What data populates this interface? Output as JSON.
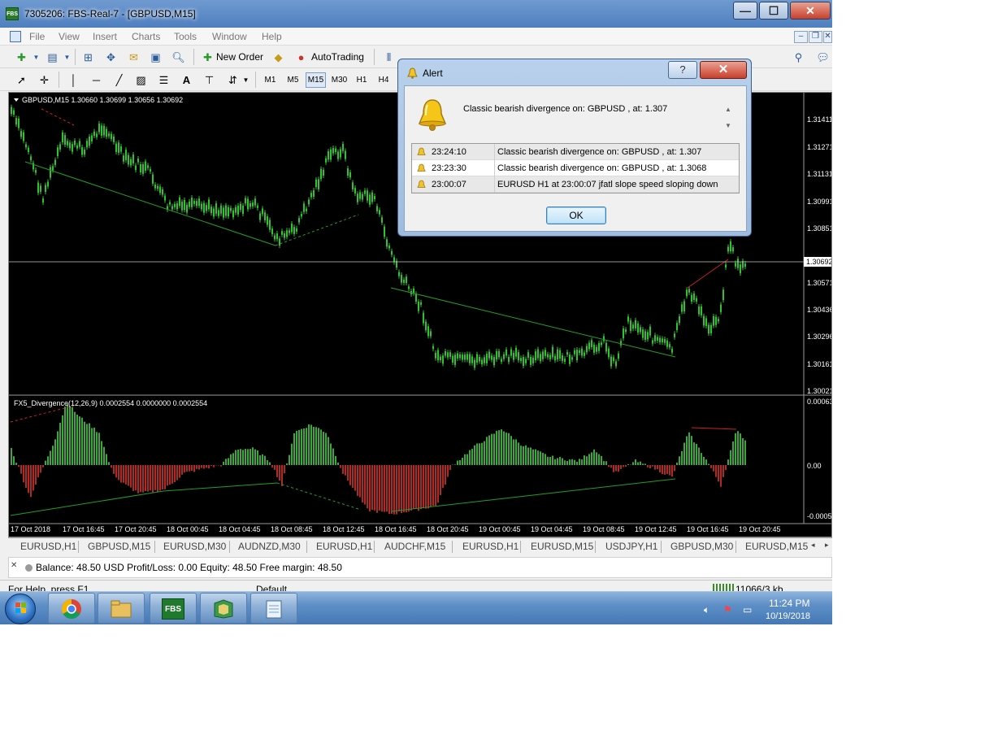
{
  "window": {
    "app_icon": "FBS",
    "title": "7305206: FBS-Real-7 - [GBPUSD,M15]",
    "minimize_label": "—",
    "maximize_label": "☐",
    "close_label": "✕"
  },
  "menu": {
    "items": [
      "File",
      "View",
      "Insert",
      "Charts",
      "Tools",
      "Window",
      "Help"
    ],
    "mdi": {
      "minimize": "–",
      "restore": "❐",
      "close": "✕"
    }
  },
  "toolbar": {
    "new_order_label": "New Order",
    "autotrading_label": "AutoTrading",
    "text_tool_label": "A",
    "timeframes": [
      "M1",
      "M5",
      "M15",
      "M30",
      "H1",
      "H4"
    ],
    "active_timeframe": "M15"
  },
  "chart": {
    "main_label": "GBPUSD,M15  1.30660 1.30699 1.30656 1.30692",
    "price_ticks": [
      "1.31411",
      "1.31271",
      "1.31131",
      "1.30991",
      "1.30851",
      "1.30716",
      "1.30571",
      "1.30436",
      "1.30296",
      "1.30161",
      "1.30021"
    ],
    "current_price": "1.30692",
    "indicator_label": "FX5_Divergence(12,26,9) 0.0002554 0.0000000 0.0002554",
    "indicator_ticks": [
      "0.00063",
      "0.00",
      "-0.00050"
    ],
    "time_ticks": [
      "17 Oct 2018",
      "17 Oct 16:45",
      "17 Oct 20:45",
      "18 Oct 00:45",
      "18 Oct 04:45",
      "18 Oct 08:45",
      "18 Oct 12:45",
      "18 Oct 16:45",
      "18 Oct 20:45",
      "19 Oct 00:45",
      "19 Oct 04:45",
      "19 Oct 08:45",
      "19 Oct 12:45",
      "19 Oct 16:45",
      "19 Oct 20:45"
    ],
    "colors": {
      "background": "#000000",
      "candles": "#2dc42d",
      "hist_up": "#3aa83a",
      "hist_down": "#b12a22",
      "axis_text": "#ffffff"
    }
  },
  "tabs": [
    "EURUSD,H1",
    "GBPUSD,M15",
    "EURUSD,M30",
    "AUDNZD,M30",
    "EURUSD,H1",
    "AUDCHF,M15",
    "EURUSD,H1",
    "EURUSD,M15",
    "USDJPY,H1",
    "GBPUSD,M30",
    "EURUSD,M15"
  ],
  "tab_scroll": {
    "left": "◂",
    "right": "▸"
  },
  "terminal": {
    "close_label": "✕",
    "balance_text": "Balance: 48.50 USD  Profit/Loss: 0.00  Equity: 48.50  Free margin: 48.50"
  },
  "status": {
    "help_text": "For Help, press F1",
    "profile": "Default",
    "traffic": "11066/3 kb"
  },
  "taskbar": {
    "fbs_label": "FBS",
    "time": "11:24 PM",
    "date": "10/19/2018"
  },
  "alert": {
    "title": "Alert",
    "help_label": "?",
    "close_label": "✕",
    "message": "Classic bearish divergence on: GBPUSD , at:  1.307",
    "rows": [
      {
        "time": "23:24:10",
        "message": "Classic bearish divergence on: GBPUSD , at:  1.307"
      },
      {
        "time": "23:23:30",
        "message": "Classic bearish divergence on: GBPUSD , at:  1.3068"
      },
      {
        "time": "23:00:07",
        "message": "EURUSD H1 at 23:00:07 jfatl slope speed  sloping down"
      }
    ],
    "ok_label": "OK"
  }
}
